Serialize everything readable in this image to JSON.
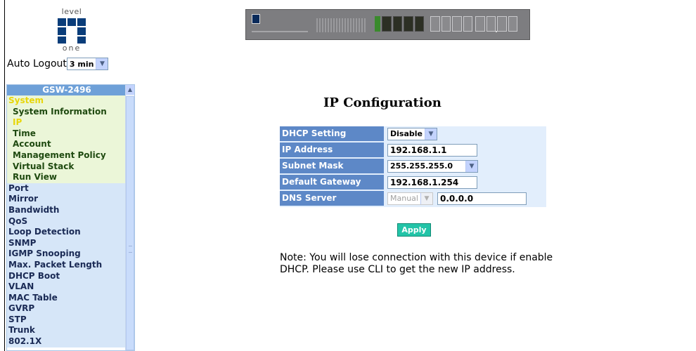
{
  "brand": {
    "word_top": "level",
    "word_bottom": "one"
  },
  "auto_logout": {
    "label": "Auto Logout",
    "value": "3 min"
  },
  "sidebar": {
    "title": "GSW-2496",
    "items": [
      {
        "label": "System",
        "kind": "group"
      },
      {
        "label": "System Information",
        "kind": "sub"
      },
      {
        "label": "IP",
        "kind": "sub",
        "active": true
      },
      {
        "label": "Time",
        "kind": "sub"
      },
      {
        "label": "Account",
        "kind": "sub"
      },
      {
        "label": "Management Policy",
        "kind": "sub"
      },
      {
        "label": "Virtual Stack",
        "kind": "sub"
      },
      {
        "label": "Run View",
        "kind": "sub"
      },
      {
        "label": "Port",
        "kind": "top"
      },
      {
        "label": "Mirror",
        "kind": "top"
      },
      {
        "label": "Bandwidth",
        "kind": "top"
      },
      {
        "label": "QoS",
        "kind": "top"
      },
      {
        "label": "Loop Detection",
        "kind": "top"
      },
      {
        "label": "SNMP",
        "kind": "top"
      },
      {
        "label": "IGMP Snooping",
        "kind": "top"
      },
      {
        "label": "Max. Packet Length",
        "kind": "top"
      },
      {
        "label": "DHCP Boot",
        "kind": "top"
      },
      {
        "label": "VLAN",
        "kind": "top"
      },
      {
        "label": "MAC Table",
        "kind": "top"
      },
      {
        "label": "GVRP",
        "kind": "top"
      },
      {
        "label": "STP",
        "kind": "top"
      },
      {
        "label": "Trunk",
        "kind": "top"
      },
      {
        "label": "802.1X",
        "kind": "top"
      }
    ]
  },
  "page": {
    "title": "IP Configuration",
    "fields": {
      "dhcp_setting": {
        "label": "DHCP Setting",
        "value": "Disable"
      },
      "ip_address": {
        "label": "IP Address",
        "value": "192.168.1.1"
      },
      "subnet_mask": {
        "label": "Subnet Mask",
        "value": "255.255.255.0"
      },
      "default_gateway": {
        "label": "Default Gateway",
        "value": "192.168.1.254"
      },
      "dns_server": {
        "label": "DNS Server",
        "mode": "Manual",
        "value": "0.0.0.0"
      }
    },
    "apply_label": "Apply",
    "note": "Note: You will lose connection with this device if enable DHCP. Please use CLI to get the new IP address."
  },
  "colors": {
    "label_bg": "#5d88c7",
    "field_bg": "#e2eefc",
    "apply_bg": "#23c4a8",
    "sidebar_active": "#e8d60a"
  }
}
